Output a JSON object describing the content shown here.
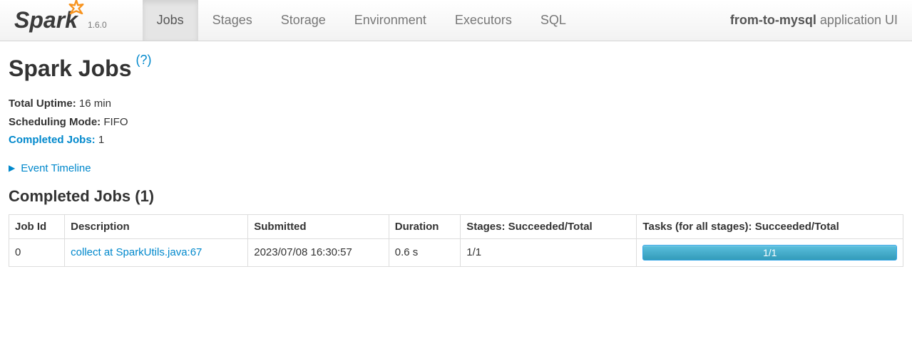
{
  "brand": {
    "name": "Spark",
    "version": "1.6.0"
  },
  "nav": {
    "tabs": [
      {
        "label": "Jobs",
        "active": true
      },
      {
        "label": "Stages",
        "active": false
      },
      {
        "label": "Storage",
        "active": false
      },
      {
        "label": "Environment",
        "active": false
      },
      {
        "label": "Executors",
        "active": false
      },
      {
        "label": "SQL",
        "active": false
      }
    ],
    "app_name": "from-to-mysql",
    "app_suffix": " application UI"
  },
  "page": {
    "title": "Spark Jobs",
    "help": "(?)"
  },
  "summary": {
    "uptime_label": "Total Uptime:",
    "uptime_value": " 16 min",
    "sched_label": "Scheduling Mode:",
    "sched_value": " FIFO",
    "completed_label": "Completed Jobs:",
    "completed_value": " 1"
  },
  "timeline": {
    "label": "Event Timeline"
  },
  "completed_section": {
    "title": "Completed Jobs (1)"
  },
  "table": {
    "headers": {
      "job_id": "Job Id",
      "description": "Description",
      "submitted": "Submitted",
      "duration": "Duration",
      "stages": "Stages: Succeeded/Total",
      "tasks": "Tasks (for all stages): Succeeded/Total"
    },
    "rows": [
      {
        "job_id": "0",
        "description": "collect at SparkUtils.java:67",
        "submitted": "2023/07/08 16:30:57",
        "duration": "0.6 s",
        "stages": "1/1",
        "tasks": "1/1"
      }
    ]
  }
}
